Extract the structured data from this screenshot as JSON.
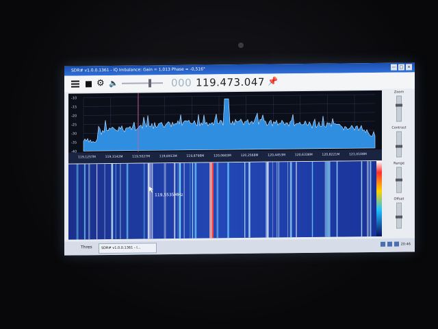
{
  "window": {
    "title": "SDR# v1.0.0.1361 - IQ Imbalance: Gain = 1,013 Phase = -0,516°",
    "buttons": [
      "—",
      "□",
      "×"
    ]
  },
  "toolbar": {
    "icons": [
      "menu-icon",
      "stop-icon",
      "gear-icon",
      "speaker-icon",
      "pin-icon"
    ],
    "volume_level": 0.7,
    "frequency_leading": "000",
    "frequency": "119.473.047"
  },
  "spectrum": {
    "y_ticks": [
      "-10",
      "-15",
      "-20",
      "-25",
      "-30",
      "-35",
      "-40"
    ],
    "x_ticks": [
      "119,1257M",
      "119,3142M",
      "119,5027M",
      "119,6913M",
      "119,8798M",
      "120,0683M",
      "120,2568M",
      "120,4453M",
      "120,6338M",
      "120,8221M",
      "121,0108M"
    ]
  },
  "waterfall": {
    "cursor_readout": "119,5535MHz"
  },
  "side_panel": {
    "labels": [
      "Zoom",
      "Contrast",
      "Range",
      "Offset"
    ],
    "levels": [
      0.35,
      0.6,
      0.5,
      0.55
    ]
  },
  "taskbar": {
    "start_label": "Thres",
    "task_label": "SDR# v1.0.0.1361 - I...",
    "clock": "20:46"
  },
  "colors": {
    "spectrum_fill": "#2f8ee0",
    "waterfall_base": "#1d3aa0",
    "title_bar": "#2f6fd8"
  }
}
